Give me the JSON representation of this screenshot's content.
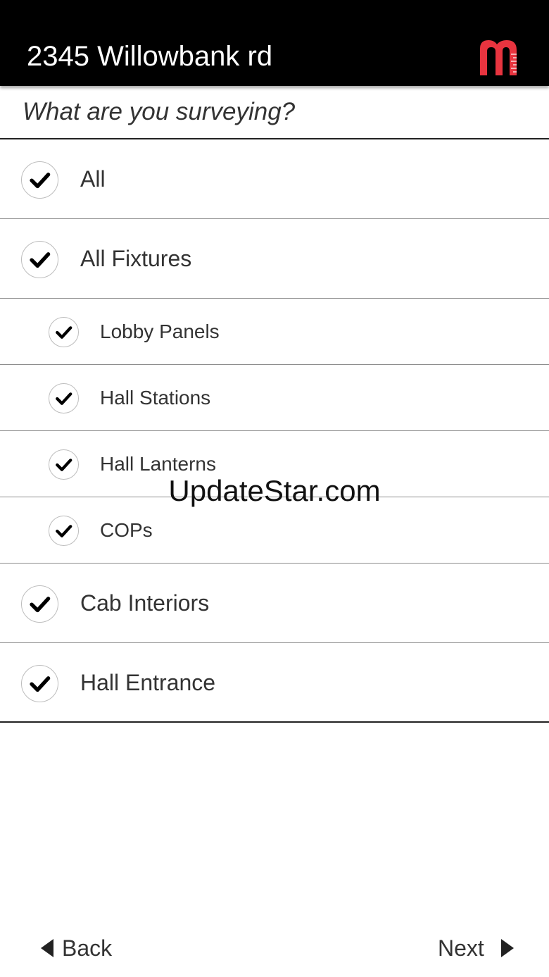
{
  "header": {
    "title": "2345 Willowbank rd",
    "logo_icon": "brand-logo-icon",
    "logo_color": "#e8343f"
  },
  "prompt": "What are you surveying?",
  "items": [
    {
      "label": "All",
      "checked": true,
      "level": 0
    },
    {
      "label": "All Fixtures",
      "checked": true,
      "level": 0
    },
    {
      "label": "Lobby Panels",
      "checked": true,
      "level": 1
    },
    {
      "label": "Hall Stations",
      "checked": true,
      "level": 1
    },
    {
      "label": "Hall Lanterns",
      "checked": true,
      "level": 1
    },
    {
      "label": "COPs",
      "checked": true,
      "level": 1
    },
    {
      "label": "Cab Interiors",
      "checked": true,
      "level": 0
    },
    {
      "label": "Hall Entrance",
      "checked": true,
      "level": 0
    }
  ],
  "watermark": "UpdateStar.com",
  "nav": {
    "back_label": "Back",
    "next_label": "Next"
  }
}
